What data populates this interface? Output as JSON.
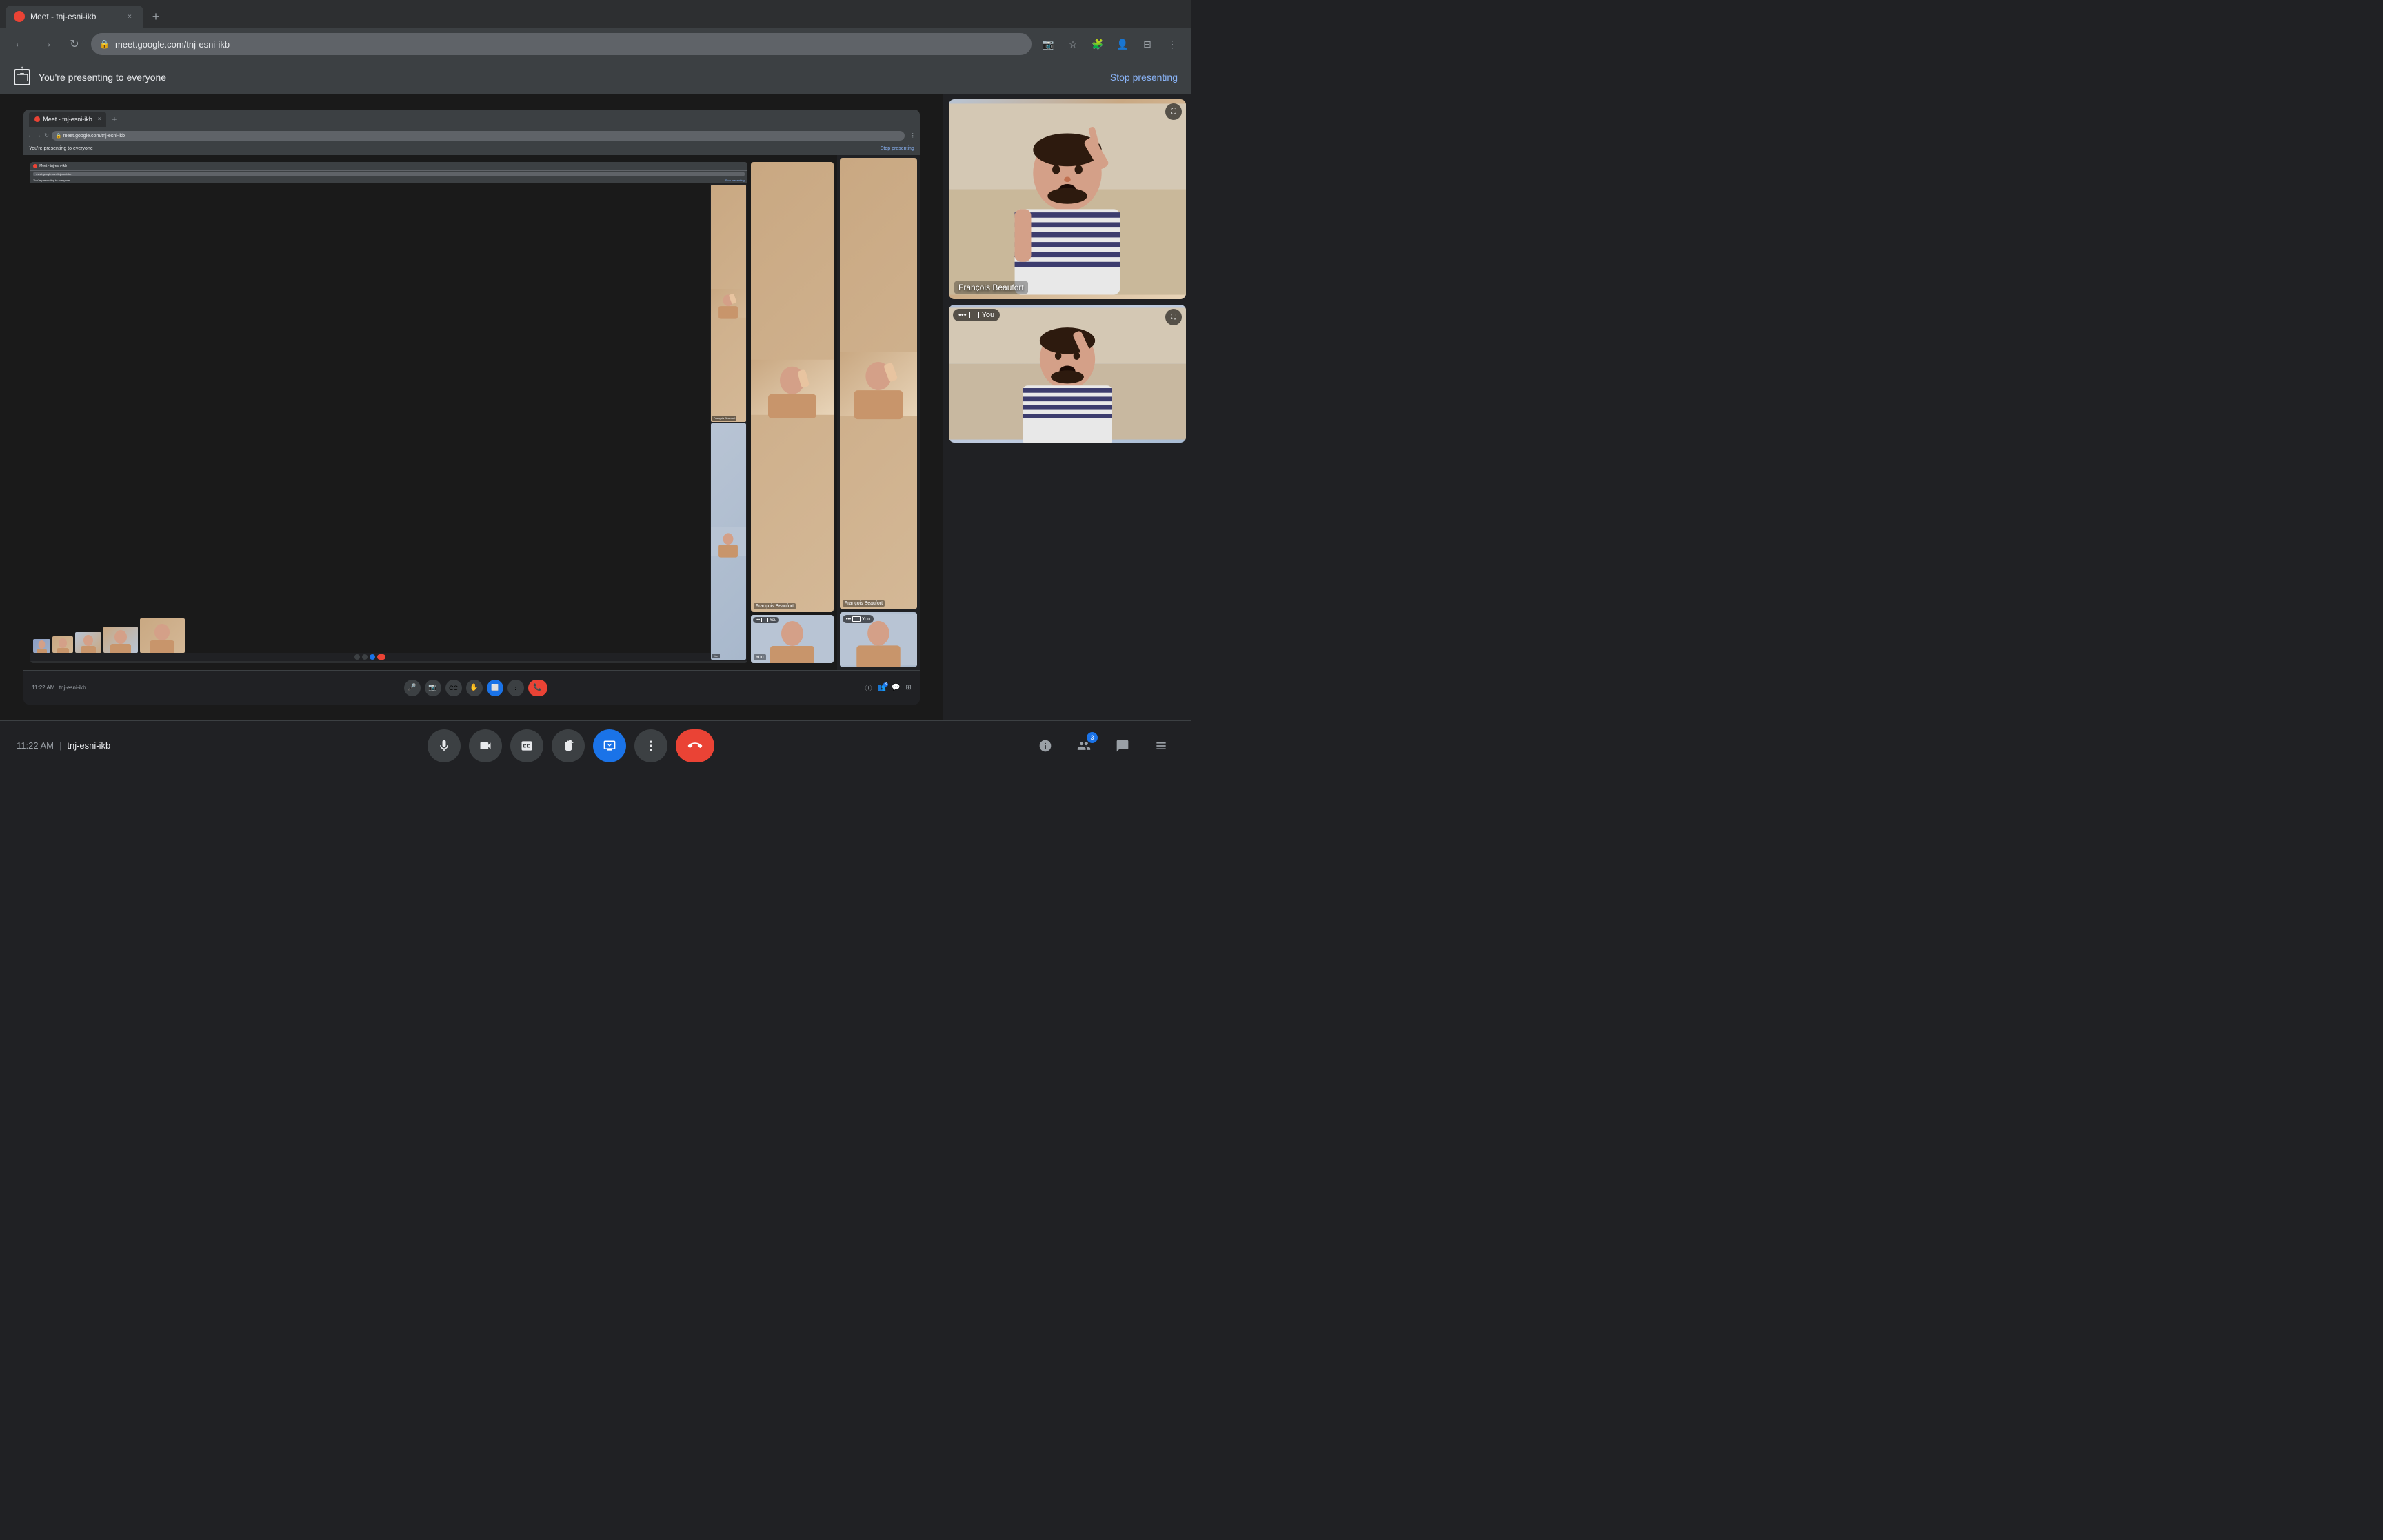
{
  "browser": {
    "tab": {
      "title": "Meet - tnj-esni-ikb",
      "favicon_color": "#ea4335",
      "close_label": "×",
      "new_tab_label": "+"
    },
    "toolbar": {
      "back_label": "←",
      "forward_label": "→",
      "reload_label": "↻",
      "url": "meet.google.com/tnj-esni-ikb",
      "more_label": "⋮"
    }
  },
  "meet": {
    "banner": {
      "message": "You're presenting to everyone",
      "stop_btn": "Stop presenting"
    },
    "nested_banner": {
      "message": "You're presenting to everyone",
      "stop_btn": "Stop presenting"
    },
    "participants": [
      {
        "name": "François Beaufort",
        "is_you": false,
        "size": "large"
      },
      {
        "name": "François Beaufort",
        "is_you": false,
        "size": "medium"
      }
    ],
    "pip": {
      "name": "You",
      "dots": "•••"
    },
    "bottom_bar": {
      "time": "11:22 AM",
      "divider": "|",
      "meeting_id": "tnj-esni-ikb",
      "controls": {
        "mic_label": "🎤",
        "camera_label": "📷",
        "captions_label": "CC",
        "hand_label": "✋",
        "present_label": "⬜",
        "more_label": "⋮",
        "end_call_label": "📞"
      },
      "right_actions": {
        "info_label": "ⓘ",
        "people_label": "👥",
        "chat_label": "💬",
        "activities_label": "⊞",
        "people_count": "3"
      }
    }
  }
}
